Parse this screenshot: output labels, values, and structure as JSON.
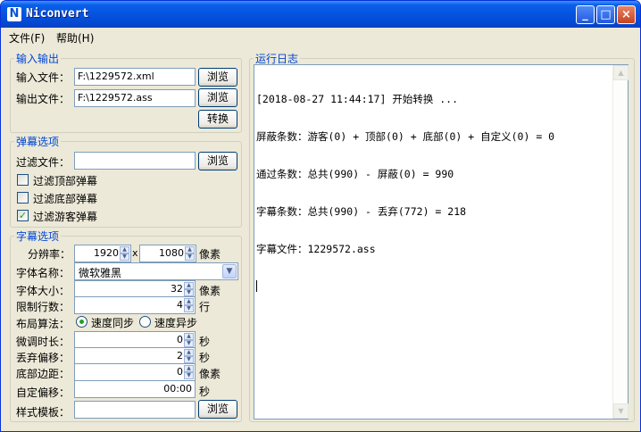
{
  "window": {
    "title": "Niconvert",
    "icon_letter": "N",
    "controls": {
      "minimize": "_",
      "maximize": "□",
      "close": "×"
    }
  },
  "menu": {
    "file": "文件(F)",
    "help": "帮助(H)"
  },
  "io": {
    "legend": "输入输出",
    "input_label": "输入文件：",
    "input_value": "F:\\1229572.xml",
    "output_label": "输出文件：",
    "output_value": "F:\\1229572.ass",
    "browse": "浏览",
    "convert": "转换"
  },
  "danmaku": {
    "legend": "弹幕选项",
    "filter_file_label": "过滤文件：",
    "filter_file_value": "",
    "browse": "浏览",
    "checks": [
      {
        "label": "过滤顶部弹幕",
        "checked": false
      },
      {
        "label": "过滤底部弹幕",
        "checked": false
      },
      {
        "label": "过滤游客弹幕",
        "checked": true
      }
    ]
  },
  "subtitle": {
    "legend": "字幕选项",
    "resolution_label": "分辨率：",
    "width": "1920",
    "x": "x",
    "height": "1080",
    "px": "像素",
    "font_name_label": "字体名称：",
    "font_name": "微软雅黑",
    "font_size_label": "字体大小：",
    "font_size": "32",
    "line_limit_label": "限制行数：",
    "line_limit": "4",
    "line_unit": "行",
    "layout_label": "布局算法：",
    "layout_sync": "速度同步",
    "layout_async": "速度异步",
    "layout_selected": "速度同步",
    "tune_label": "微调时长：",
    "tune": "0",
    "sec": "秒",
    "drop_label": "丢弃偏移：",
    "drop": "2",
    "bottom_label": "底部边距：",
    "bottom": "0",
    "custom_offset_label": "自定偏移：",
    "custom_offset": "00:00",
    "style_label": "样式模板：",
    "style_value": "",
    "browse": "浏览"
  },
  "log": {
    "legend": "运行日志",
    "lines": [
      "[2018-08-27 11:44:17] 开始转换 ...",
      "屏蔽条数：游客(0) + 顶部(0) + 底部(0) + 自定义(0) = 0",
      "通过条数：总共(990) - 屏蔽(0) = 990",
      "字幕条数：总共(990) - 丢弃(772) = 218",
      "字幕文件：1229572.ass"
    ]
  },
  "colors": {
    "title_bar": "#0553e0",
    "legend_text": "#0046d5",
    "window_bg": "#ece9d8",
    "check_mark": "#21a121"
  }
}
